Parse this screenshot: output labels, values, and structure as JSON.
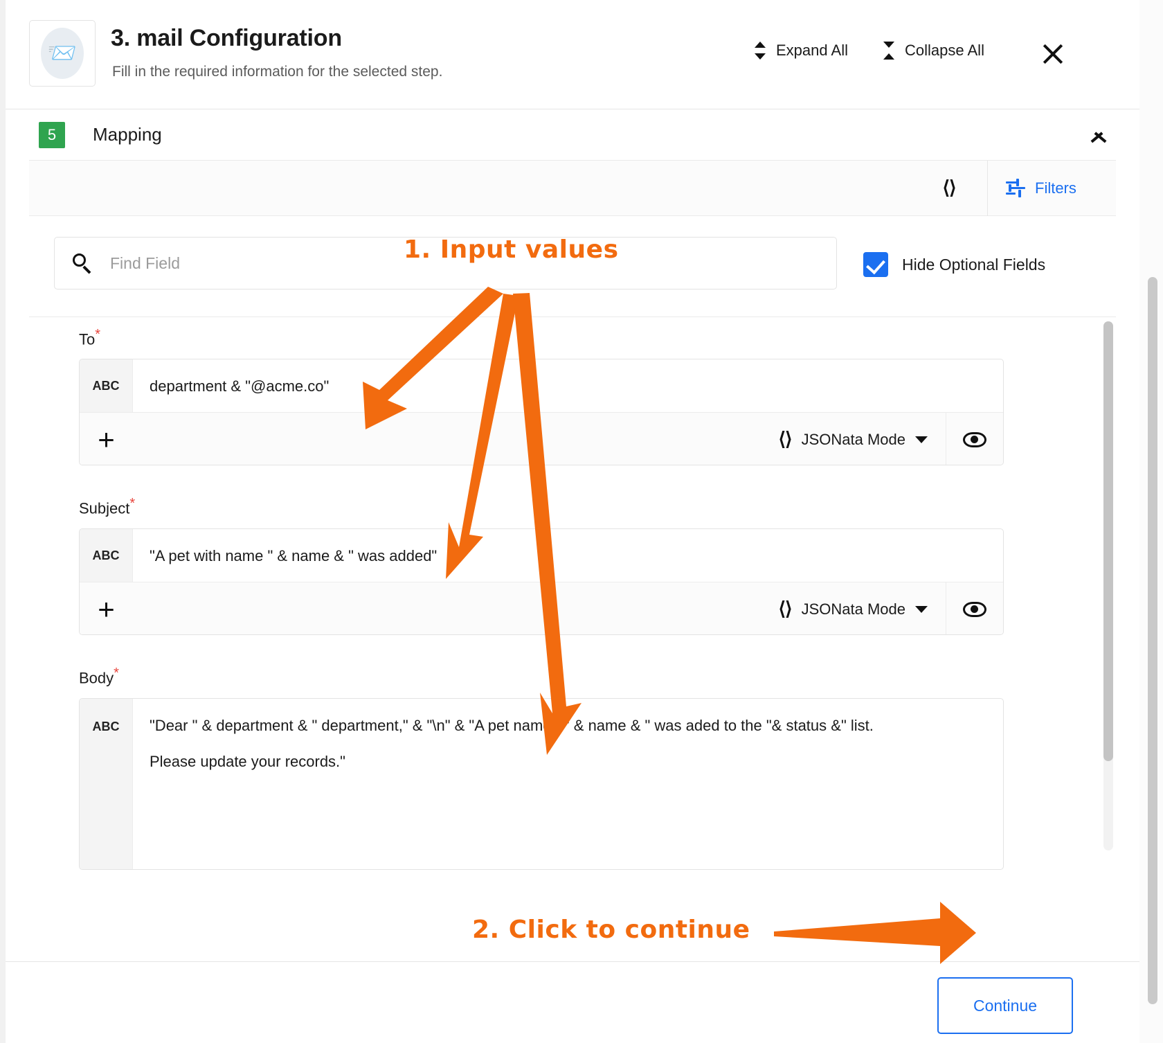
{
  "header": {
    "icon": "mail-envelope-icon",
    "title": "3. mail Configuration",
    "subtitle": "Fill in the required information for the selected step.",
    "expand_all_label": "Expand All",
    "collapse_all_label": "Collapse All",
    "close_label": "×"
  },
  "section": {
    "step_number": "5",
    "title": "Mapping",
    "collapse_chevron": "chevron-up-icon"
  },
  "toolbar": {
    "code_toggle_icon": "‹›",
    "filters_label": "Filters",
    "filters_icon": "sliders-icon"
  },
  "search": {
    "placeholder": "Find Field",
    "value": "",
    "icon": "search-icon",
    "hide_optional_label": "Hide Optional Fields",
    "hide_optional_checked": true
  },
  "fields": [
    {
      "label": "To",
      "required_marker": "*",
      "type_badge": "ABC",
      "value": "department & \"@acme.co\"",
      "add_label": "+",
      "mode_label": "JSONata Mode",
      "mode_icon": "code-brackets-icon",
      "preview_icon": "eye-icon"
    },
    {
      "label": "Subject",
      "required_marker": "*",
      "type_badge": "ABC",
      "value": "\"A pet with name \" & name & \" was added\"",
      "add_label": "+",
      "mode_label": "JSONata Mode",
      "mode_icon": "code-brackets-icon",
      "preview_icon": "eye-icon"
    },
    {
      "label": "Body",
      "required_marker": "*",
      "type_badge": "ABC",
      "value_line_1": "\"Dear \" & department & \" department,\" & \"\\n\" & \"A pet named \" & name & \" was aded to the \"& status &\" list.",
      "value_line_2": "Please update your records.\""
    }
  ],
  "footer": {
    "continue_label": "Continue"
  },
  "annotations": [
    {
      "text": "1. Input values",
      "color": "#F26B0F"
    },
    {
      "text": "2. Click to continue",
      "color": "#F26B0F"
    }
  ],
  "colors": {
    "accent_blue": "#1b6ff0",
    "step_green": "#2fa44f",
    "annotation_orange": "#F26B0F",
    "required_red": "#e8453c"
  }
}
